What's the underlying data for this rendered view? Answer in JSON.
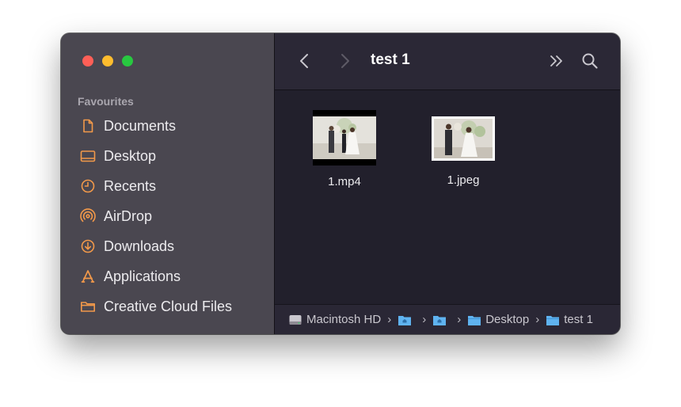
{
  "window": {
    "title": "test 1"
  },
  "sidebar": {
    "section_title": "Favourites",
    "items": [
      {
        "label": "Documents",
        "icon": "document-icon"
      },
      {
        "label": "Desktop",
        "icon": "desktop-icon"
      },
      {
        "label": "Recents",
        "icon": "clock-icon"
      },
      {
        "label": "AirDrop",
        "icon": "airdrop-icon"
      },
      {
        "label": "Downloads",
        "icon": "download-icon"
      },
      {
        "label": "Applications",
        "icon": "applications-icon"
      },
      {
        "label": "Creative Cloud Files",
        "icon": "folder-icon"
      }
    ]
  },
  "files": [
    {
      "name": "1.mp4",
      "kind": "video"
    },
    {
      "name": "1.jpeg",
      "kind": "image"
    }
  ],
  "pathbar": {
    "items": [
      {
        "label": "Macintosh HD",
        "icon": "hard-drive-icon"
      },
      {
        "label": "",
        "icon": "home-folder-icon"
      },
      {
        "label": "",
        "icon": "home-folder-icon"
      },
      {
        "label": "Desktop",
        "icon": "folder-icon"
      },
      {
        "label": "test 1",
        "icon": "folder-icon"
      }
    ],
    "separator": "›"
  },
  "colors": {
    "accent_icon": "#f2994a",
    "folder_blue": "#5fb3f0"
  }
}
